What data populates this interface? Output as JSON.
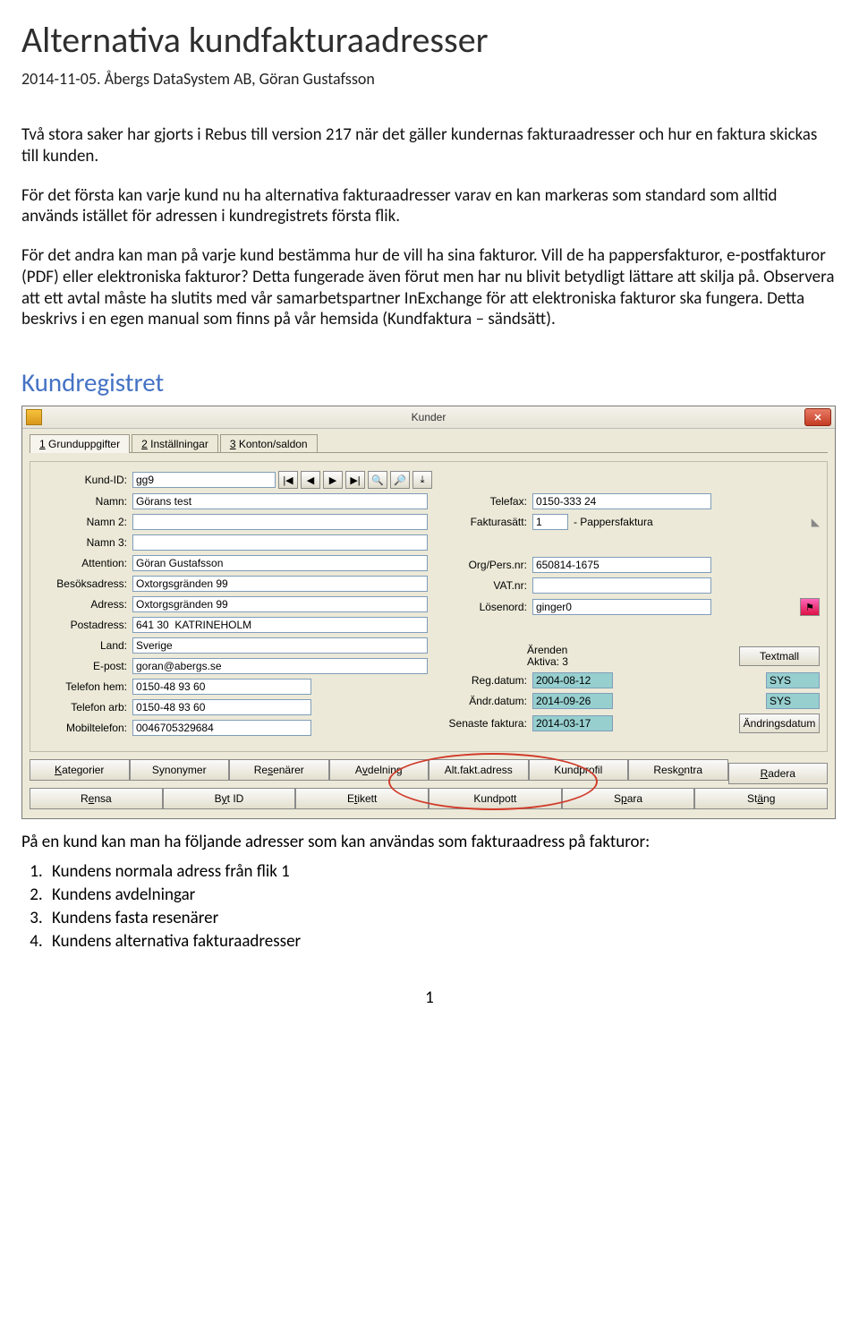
{
  "doc": {
    "title": "Alternativa kundfakturaadresser",
    "byline": "2014-11-05. Åbergs DataSystem AB, Göran Gustafsson",
    "p1": "Två stora saker har gjorts i Rebus till version 217 när det gäller kundernas fakturaadresser och hur en faktura skickas till kunden.",
    "p2": "För det första kan varje kund nu ha alternativa fakturaadresser varav en kan markeras som standard som alltid används istället för adressen i kundregistrets första flik.",
    "p3": "För det andra kan man på varje kund bestämma hur de vill ha sina fakturor. Vill de ha pappersfakturor, e-postfakturor (PDF) eller elektroniska fakturor? Detta fungerade även förut men har nu blivit betydligt lättare att skilja på. Observera att ett avtal måste ha slutits med vår samarbetspartner InExchange för att elektroniska fakturor ska fungera. Detta beskrivs i en egen manual som finns på vår hemsida (Kundfaktura – sändsätt).",
    "section": "Kundregistret",
    "after": "På en kund kan man ha följande adresser som kan användas som fakturaadress på fakturor:",
    "list": [
      "Kundens normala adress från flik 1",
      "Kundens avdelningar",
      "Kundens fasta resenärer",
      "Kundens alternativa fakturaadresser"
    ],
    "pagenum": "1"
  },
  "win": {
    "title": "Kunder",
    "close": "✕",
    "tabs": [
      "Grunduppgifter",
      "Inställningar",
      "Konton/saldon"
    ],
    "tabnums": [
      "1",
      "2",
      "3"
    ],
    "labels": {
      "kundid": "Kund-ID:",
      "namn": "Namn:",
      "namn2": "Namn 2:",
      "namn3": "Namn 3:",
      "attention": "Attention:",
      "besok": "Besöksadress:",
      "adress": "Adress:",
      "post": "Postadress:",
      "land": "Land:",
      "epost": "E-post:",
      "telhem": "Telefon hem:",
      "telarb": "Telefon arb:",
      "mobil": "Mobiltelefon:",
      "telefax": "Telefax:",
      "fakturasatt": "Fakturasätt:",
      "orgpers": "Org/Pers.nr:",
      "vatnr": "VAT.nr:",
      "losen": "Lösenord:",
      "arenden": "Ärenden",
      "aktiva": "Aktiva: 3",
      "textmall": "Textmall",
      "regdatum": "Reg.datum:",
      "andrdatum": "Ändr.datum:",
      "senaste": "Senaste faktura:",
      "andringsdatum": "Ändringsdatum"
    },
    "values": {
      "kundid": "gg9",
      "namn": "Görans test",
      "attention": "Göran Gustafsson",
      "besok": "Oxtorgsgränden 99",
      "adress": "Oxtorgsgränden 99",
      "post": "641 30  KATRINEHOLM",
      "land": "Sverige",
      "epost": "goran@abergs.se",
      "telhem": "0150-48 93 60",
      "telarb": "0150-48 93 60",
      "mobil": "0046705329684",
      "telefax": "0150-333 24",
      "fakturasatt_code": "1",
      "fakturasatt_text": "- Pappersfaktura",
      "orgpers": "650814-1675",
      "losen": "ginger0",
      "regdatum": "2004-08-12",
      "regdatum_by": "SYS",
      "andrdatum": "2014-09-26",
      "andrdatum_by": "SYS",
      "senaste": "2014-03-17"
    },
    "toolbar_icons": [
      "|◀",
      "◀",
      "▶",
      "▶|",
      "🔍",
      "🔎",
      "⤓"
    ],
    "buttons_row1": [
      "Kategorier",
      "Synonymer",
      "Resenärer",
      "Avdelning",
      "Alt.fakt.adress",
      "Kundprofil",
      "Reskontra"
    ],
    "buttons_row2": [
      "Radera",
      "Rensa",
      "Byt ID",
      "Etikett",
      "Kundpott",
      "Spara",
      "Stäng"
    ]
  }
}
